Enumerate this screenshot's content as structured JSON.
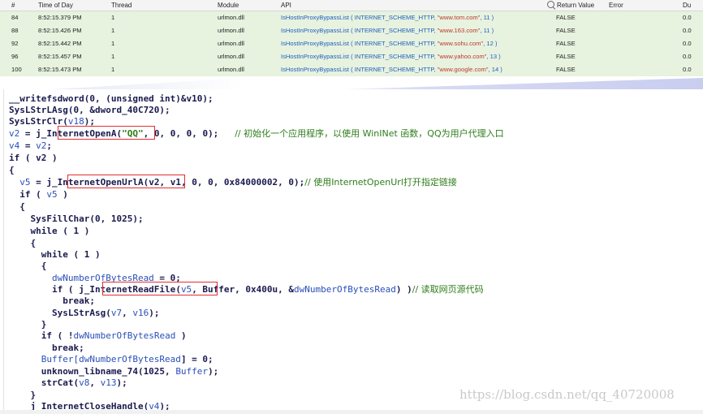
{
  "table": {
    "columns": [
      "#",
      "Time of Day",
      "Thread",
      "Module",
      "API",
      "Return Value",
      "Error",
      "Du"
    ],
    "rows": [
      {
        "num": "84",
        "time": "8:52:15.379 PM",
        "thread": "1",
        "module": "urlmon.dll",
        "api_pre": "IsHostInProxyBypassList ( INTERNET_SCHEME_HTTP, ",
        "api_str": "\"www.tom.com\"",
        "api_post": ", 11 )",
        "ret": "FALSE",
        "err": "",
        "du": "0.0"
      },
      {
        "num": "88",
        "time": "8:52:15.426 PM",
        "thread": "1",
        "module": "urlmon.dll",
        "api_pre": "IsHostInProxyBypassList ( INTERNET_SCHEME_HTTP, ",
        "api_str": "\"www.163.com\"",
        "api_post": ", 11 )",
        "ret": "FALSE",
        "err": "",
        "du": "0.0"
      },
      {
        "num": "92",
        "time": "8:52:15.442 PM",
        "thread": "1",
        "module": "urlmon.dll",
        "api_pre": "IsHostInProxyBypassList ( INTERNET_SCHEME_HTTP, ",
        "api_str": "\"www.sohu.com\"",
        "api_post": ", 12 )",
        "ret": "FALSE",
        "err": "",
        "du": "0.0"
      },
      {
        "num": "96",
        "time": "8:52:15.457 PM",
        "thread": "1",
        "module": "urlmon.dll",
        "api_pre": "IsHostInProxyBypassList ( INTERNET_SCHEME_HTTP, ",
        "api_str": "\"www.yahoo.com\"",
        "api_post": ", 13 )",
        "ret": "FALSE",
        "err": "",
        "du": "0.0"
      },
      {
        "num": "100",
        "time": "8:52:15.473 PM",
        "thread": "1",
        "module": "urlmon.dll",
        "api_pre": "IsHostInProxyBypassList ( INTERNET_SCHEME_HTTP, ",
        "api_str": "\"www.google.com\"",
        "api_post": ", 14 )",
        "ret": "FALSE",
        "err": "",
        "du": "0.0"
      }
    ]
  },
  "code": {
    "l1": "__writefsdword(0, (unsigned int)&v10);",
    "l2": "SysLStrLAsg(0, &dword_40C720);",
    "l3a": "SysLStrClr(",
    "l3b": "v18",
    "l3c": ");",
    "l4a": "v2",
    "l4b": " = ",
    "l4c": "j_InternetOpenA",
    "l4d": "(",
    "l4e": "\"QQ\"",
    "l4f": ", 0, 0, 0, 0);   ",
    "l4cm": "// 初始化一个应用程序，以使用 WinINet 函数，QQ为用户代理入口",
    "l5a": "v4",
    "l5b": " = ",
    "l5c": "v2",
    "l5d": ";",
    "l6": "if ( v2 )",
    "l7": "{",
    "l8a": "  v5",
    "l8b": " = ",
    "l8c": "j_InternetOpenUrlA",
    "l8d": "(",
    "l8e": "v2, v1, 0, 0, 0x84000002, 0);",
    "l8cm": "// 使用InternetOpenUrl打开指定链接",
    "l9a": "  if ( ",
    "l9b": "v5",
    "l9c": " )",
    "l10": "  {",
    "l11": "    SysFillChar(0, 1025);",
    "l12": "    while ( 1 )",
    "l13": "    {",
    "l14": "      while ( 1 )",
    "l15": "      {",
    "l16a": "        dwNumberOfBytesRead",
    "l16b": " = 0;",
    "l17a": "        if ( ",
    "l17b": "j_InternetReadFile",
    "l17c": "(",
    "l17d": "v5",
    "l17e": ", Buffer, 0x400u, &",
    "l17f": "dwNumberOfBytesRead",
    "l17g": ") )",
    "l17cm": "// 读取网页源代码",
    "l18": "          break;",
    "l19a": "        SysLStrAsg(",
    "l19b": "v7",
    "l19c": ", ",
    "l19d": "v16",
    "l19e": ");",
    "l20": "      }",
    "l21a": "      if ( !",
    "l21b": "dwNumberOfBytesRead",
    "l21c": " )",
    "l22": "        break;",
    "l23a": "      Buffer[",
    "l23b": "dwNumberOfBytesRead",
    "l23c": "] = 0;",
    "l24a": "      unknown_libname_74(1025, ",
    "l24b": "Buffer",
    "l24c": ");",
    "l25a": "      strCat(",
    "l25b": "v8",
    "l25c": ", ",
    "l25d": "v13",
    "l25e": ");",
    "l26": "    }",
    "l27a": "    j_InternetCloseHandle(",
    "l27b": "v4",
    "l27c": ");"
  },
  "watermark": "https://blog.csdn.net/qq_40720008"
}
